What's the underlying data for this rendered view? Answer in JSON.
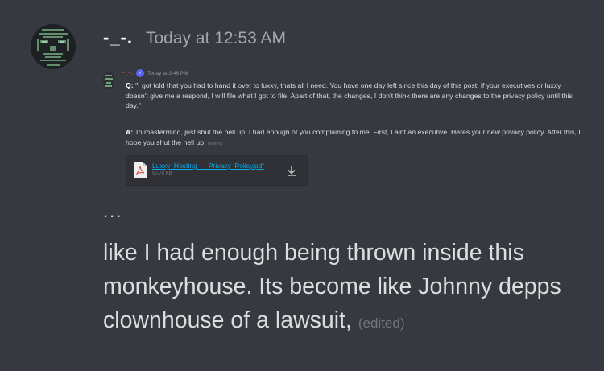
{
  "message": {
    "username": "-_-.",
    "timestamp": "Today at 12:53 AM",
    "ellipsis": "...",
    "body": "like I had enough being thrown inside this monkeyhouse. Its become like Johnny depps clownhouse of a lawsuit,",
    "edited_label": "(edited)"
  },
  "embedded_screenshot": {
    "username": "~_~.",
    "timestamp": "Today at 3:46 PM",
    "q_label": "Q:",
    "q_text": "\"I got told that you had to hand it over to luxxy, thats all I need. You have one day left since this day of this post, if your executives or luxxy doesn't give me a respond, I will file what I got to file. Apart of that, the changes, I don't think there are any changes to the privacy policy until this day.\"",
    "a_label": "A:",
    "a_text": "To mastermind, just shut the hell up. I had enough of you complaining to me. First, I aint an executive. Heres your new privacy policy. After this, I hope you shut the hell up.",
    "edited_label": "(edited)",
    "attachment": {
      "file_name": "Luxxy_Hosting___Privacy_Policy.pdf",
      "file_size": "50.78 KB",
      "file_icon": "pdf-file-icon",
      "download_icon": "download-icon"
    }
  },
  "colors": {
    "background": "#36393f",
    "username": "#ffffff",
    "timestamp": "#a3a6aa",
    "text": "#dcddde",
    "link": "#00aff4",
    "verified": "#5865f2"
  }
}
